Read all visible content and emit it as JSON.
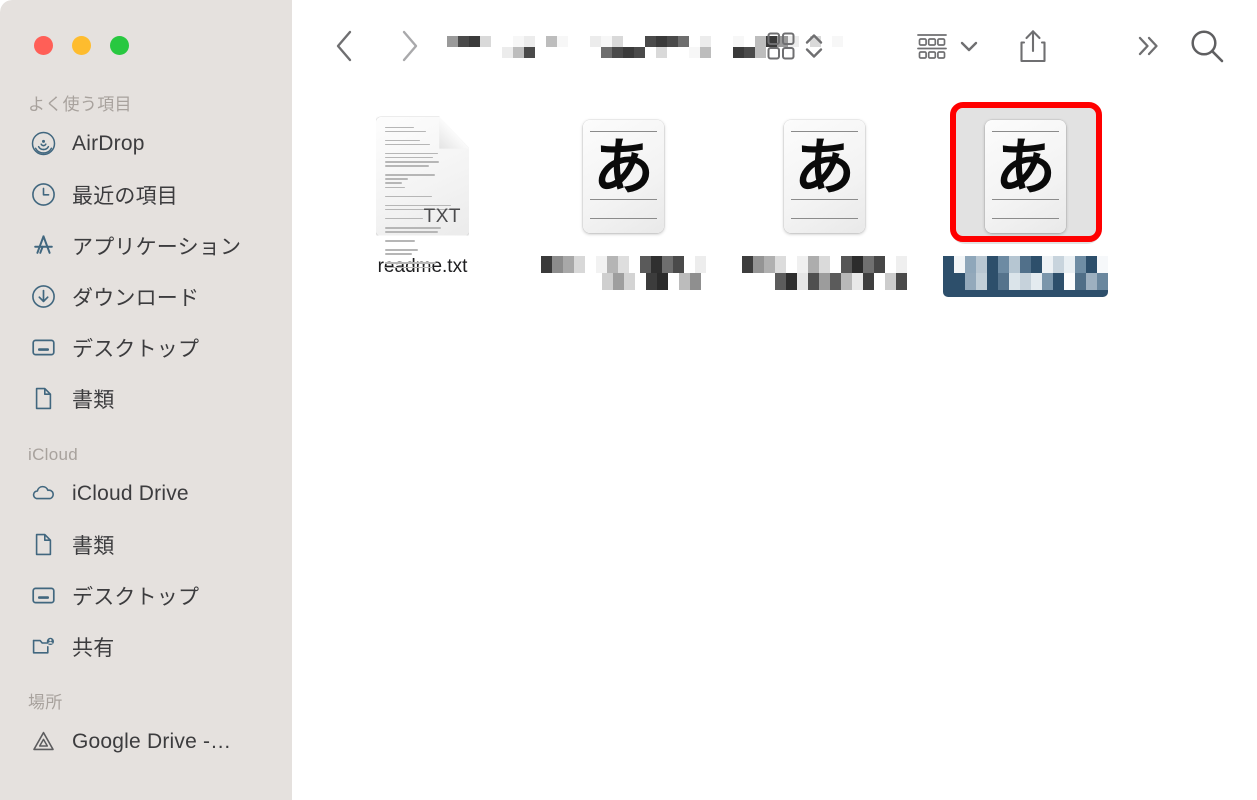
{
  "window": {
    "title_redacted": true,
    "traffic_lights": [
      {
        "name": "close",
        "color": "#ff5f57"
      },
      {
        "name": "minimize",
        "color": "#febc2e"
      },
      {
        "name": "maximize",
        "color": "#28c840"
      }
    ],
    "sidebar_bg": "#e5e1de",
    "content_bg": "#ffffff",
    "accent_color": "#41677f"
  },
  "toolbar": {
    "back_icon": "chevron-left-icon",
    "forward_icon": "chevron-right-icon",
    "title": "",
    "title_note": "redacted/pixelated path title",
    "icon_view_icon": "grid-view-icon",
    "icon_view_sort_icon": "chevron-up-down-icon",
    "group_by_icon": "group-by-icon",
    "group_by_chevron_icon": "chevron-down-icon",
    "share_icon": "share-icon",
    "more_icon": "double-chevron-right-icon",
    "search_icon": "search-icon"
  },
  "sidebar": {
    "sections": [
      {
        "header": "よく使う項目",
        "items": [
          {
            "label": "AirDrop",
            "icon": "airdrop-icon",
            "selected": false
          },
          {
            "label": "最近の項目",
            "icon": "clock-icon",
            "selected": false
          },
          {
            "label": "アプリケーション",
            "icon": "applications-icon",
            "selected": false
          },
          {
            "label": "ダウンロード",
            "icon": "downloads-icon",
            "selected": false
          },
          {
            "label": "デスクトップ",
            "icon": "desktop-icon",
            "selected": false
          },
          {
            "label": "書類",
            "icon": "document-icon",
            "selected": false
          }
        ]
      },
      {
        "header": "iCloud",
        "items": [
          {
            "label": "iCloud Drive",
            "icon": "cloud-icon",
            "selected": false
          },
          {
            "label": "書類",
            "icon": "document-icon",
            "selected": false
          },
          {
            "label": "デスクトップ",
            "icon": "desktop-icon",
            "selected": false
          },
          {
            "label": "共有",
            "icon": "shared-folder-icon",
            "selected": false
          }
        ]
      },
      {
        "header": "場所",
        "items": [
          {
            "label": "Google Drive -…",
            "icon": "google-drive-icon",
            "selected": false
          }
        ]
      }
    ]
  },
  "files": [
    {
      "name": "readme.txt",
      "name_redacted": false,
      "icon": "txt-document-icon",
      "extension_badge": "TXT",
      "selected": false,
      "annotated": false
    },
    {
      "name": "",
      "name_redacted": true,
      "icon": "font-file-icon",
      "glyph": "あ",
      "selected": false,
      "annotated": false,
      "redaction": {
        "lines": [
          [
            {
              "w": 11,
              "c": "#3a3a3a"
            },
            {
              "w": 11,
              "c": "#8c8c8c"
            },
            {
              "w": 11,
              "c": "#a8a8a8"
            },
            {
              "w": 11,
              "c": "#d8d8d8"
            },
            {
              "w": 11,
              "c": "#ffffff"
            },
            {
              "w": 11,
              "c": "#f2f2f2"
            },
            {
              "w": 11,
              "c": "#b5b5b5"
            },
            {
              "w": 11,
              "c": "#dedede"
            },
            {
              "w": 11,
              "c": "#ffffff"
            },
            {
              "w": 11,
              "c": "#5a5a5a"
            },
            {
              "w": 11,
              "c": "#2f2f2f"
            },
            {
              "w": 11,
              "c": "#6e6e6e"
            },
            {
              "w": 11,
              "c": "#4a4a4a"
            },
            {
              "w": 11,
              "c": "#ffffff"
            },
            {
              "w": 11,
              "c": "#ededed"
            }
          ],
          [
            {
              "w": 11,
              "c": "#ffffff"
            },
            {
              "w": 11,
              "c": "#ffffff"
            },
            {
              "w": 11,
              "c": "#ffffff"
            },
            {
              "w": 11,
              "c": "#ffffff"
            },
            {
              "w": 11,
              "c": "#ffffff"
            },
            {
              "w": 11,
              "c": "#cfcfcf"
            },
            {
              "w": 11,
              "c": "#9e9e9e"
            },
            {
              "w": 11,
              "c": "#d4d4d4"
            },
            {
              "w": 11,
              "c": "#ffffff"
            },
            {
              "w": 11,
              "c": "#3c3c3c"
            },
            {
              "w": 11,
              "c": "#2b2b2b"
            },
            {
              "w": 11,
              "c": "#ffffff"
            },
            {
              "w": 11,
              "c": "#bcbcbc"
            },
            {
              "w": 11,
              "c": "#8f8f8f"
            }
          ]
        ]
      }
    },
    {
      "name": "",
      "name_redacted": true,
      "icon": "font-file-icon",
      "glyph": "あ",
      "selected": false,
      "annotated": false,
      "redaction": {
        "lines": [
          [
            {
              "w": 11,
              "c": "#3d3d3d"
            },
            {
              "w": 11,
              "c": "#949494"
            },
            {
              "w": 11,
              "c": "#b0b0b0"
            },
            {
              "w": 11,
              "c": "#dcdcdc"
            },
            {
              "w": 11,
              "c": "#ffffff"
            },
            {
              "w": 11,
              "c": "#f0f0f0"
            },
            {
              "w": 11,
              "c": "#adadad"
            },
            {
              "w": 11,
              "c": "#dadada"
            },
            {
              "w": 11,
              "c": "#ffffff"
            },
            {
              "w": 11,
              "c": "#565656"
            },
            {
              "w": 11,
              "c": "#2c2c2c"
            },
            {
              "w": 11,
              "c": "#707070"
            },
            {
              "w": 11,
              "c": "#474747"
            },
            {
              "w": 11,
              "c": "#ffffff"
            },
            {
              "w": 11,
              "c": "#efefef"
            }
          ],
          [
            {
              "w": 11,
              "c": "#ffffff"
            },
            {
              "w": 11,
              "c": "#ffffff"
            },
            {
              "w": 11,
              "c": "#ffffff"
            },
            {
              "w": 11,
              "c": "#5c5c5c"
            },
            {
              "w": 11,
              "c": "#2e2e2e"
            },
            {
              "w": 11,
              "c": "#e6e6e6"
            },
            {
              "w": 11,
              "c": "#4f4f4f"
            },
            {
              "w": 11,
              "c": "#9c9c9c"
            },
            {
              "w": 11,
              "c": "#5b5b5b"
            },
            {
              "w": 11,
              "c": "#b8b8b8"
            },
            {
              "w": 11,
              "c": "#e8e8e8"
            },
            {
              "w": 11,
              "c": "#3f3f3f"
            },
            {
              "w": 11,
              "c": "#ffffff"
            },
            {
              "w": 11,
              "c": "#cccccc"
            },
            {
              "w": 11,
              "c": "#4a4a4a"
            }
          ]
        ]
      }
    },
    {
      "name": "",
      "name_redacted": true,
      "icon": "font-file-icon",
      "glyph": "あ",
      "selected": true,
      "annotated": true,
      "selection_bg": "#2d4f6b",
      "redaction": {
        "lines": [
          [
            {
              "w": 11,
              "c": "#2d4f6b"
            },
            {
              "w": 11,
              "c": "#f2f5f7"
            },
            {
              "w": 11,
              "c": "#8fa7ba"
            },
            {
              "w": 11,
              "c": "#b9c7d2"
            },
            {
              "w": 11,
              "c": "#2d4f6b"
            },
            {
              "w": 11,
              "c": "#6d8ba3"
            },
            {
              "w": 11,
              "c": "#b6c6d2"
            },
            {
              "w": 11,
              "c": "#51708a"
            },
            {
              "w": 11,
              "c": "#2d4f6b"
            },
            {
              "w": 11,
              "c": "#eef2f5"
            },
            {
              "w": 11,
              "c": "#c8d4dd"
            },
            {
              "w": 11,
              "c": "#e9eff3"
            },
            {
              "w": 11,
              "c": "#6f8da4"
            },
            {
              "w": 11,
              "c": "#2d4f6b"
            },
            {
              "w": 11,
              "c": "#f6f8fa"
            }
          ],
          [
            {
              "w": 11,
              "c": "#2d4f6b"
            },
            {
              "w": 11,
              "c": "#2d4f6b"
            },
            {
              "w": 11,
              "c": "#93a9bb"
            },
            {
              "w": 11,
              "c": "#c2cfd8"
            },
            {
              "w": 11,
              "c": "#2d4f6b"
            },
            {
              "w": 11,
              "c": "#55738c"
            },
            {
              "w": 11,
              "c": "#dbe4ea"
            },
            {
              "w": 11,
              "c": "#c6d2db"
            },
            {
              "w": 11,
              "c": "#e4ebf0"
            },
            {
              "w": 11,
              "c": "#7b96ab"
            },
            {
              "w": 11,
              "c": "#2d4f6b"
            },
            {
              "w": 11,
              "c": "#fbfcfd"
            },
            {
              "w": 11,
              "c": "#4f6e87"
            },
            {
              "w": 11,
              "c": "#9db0c0"
            },
            {
              "w": 11,
              "c": "#6a879e"
            }
          ]
        ]
      }
    }
  ],
  "annotation": {
    "color": "#ff0000",
    "shape": "rounded-rectangle",
    "stroke_width": 6,
    "target_index": 3
  }
}
